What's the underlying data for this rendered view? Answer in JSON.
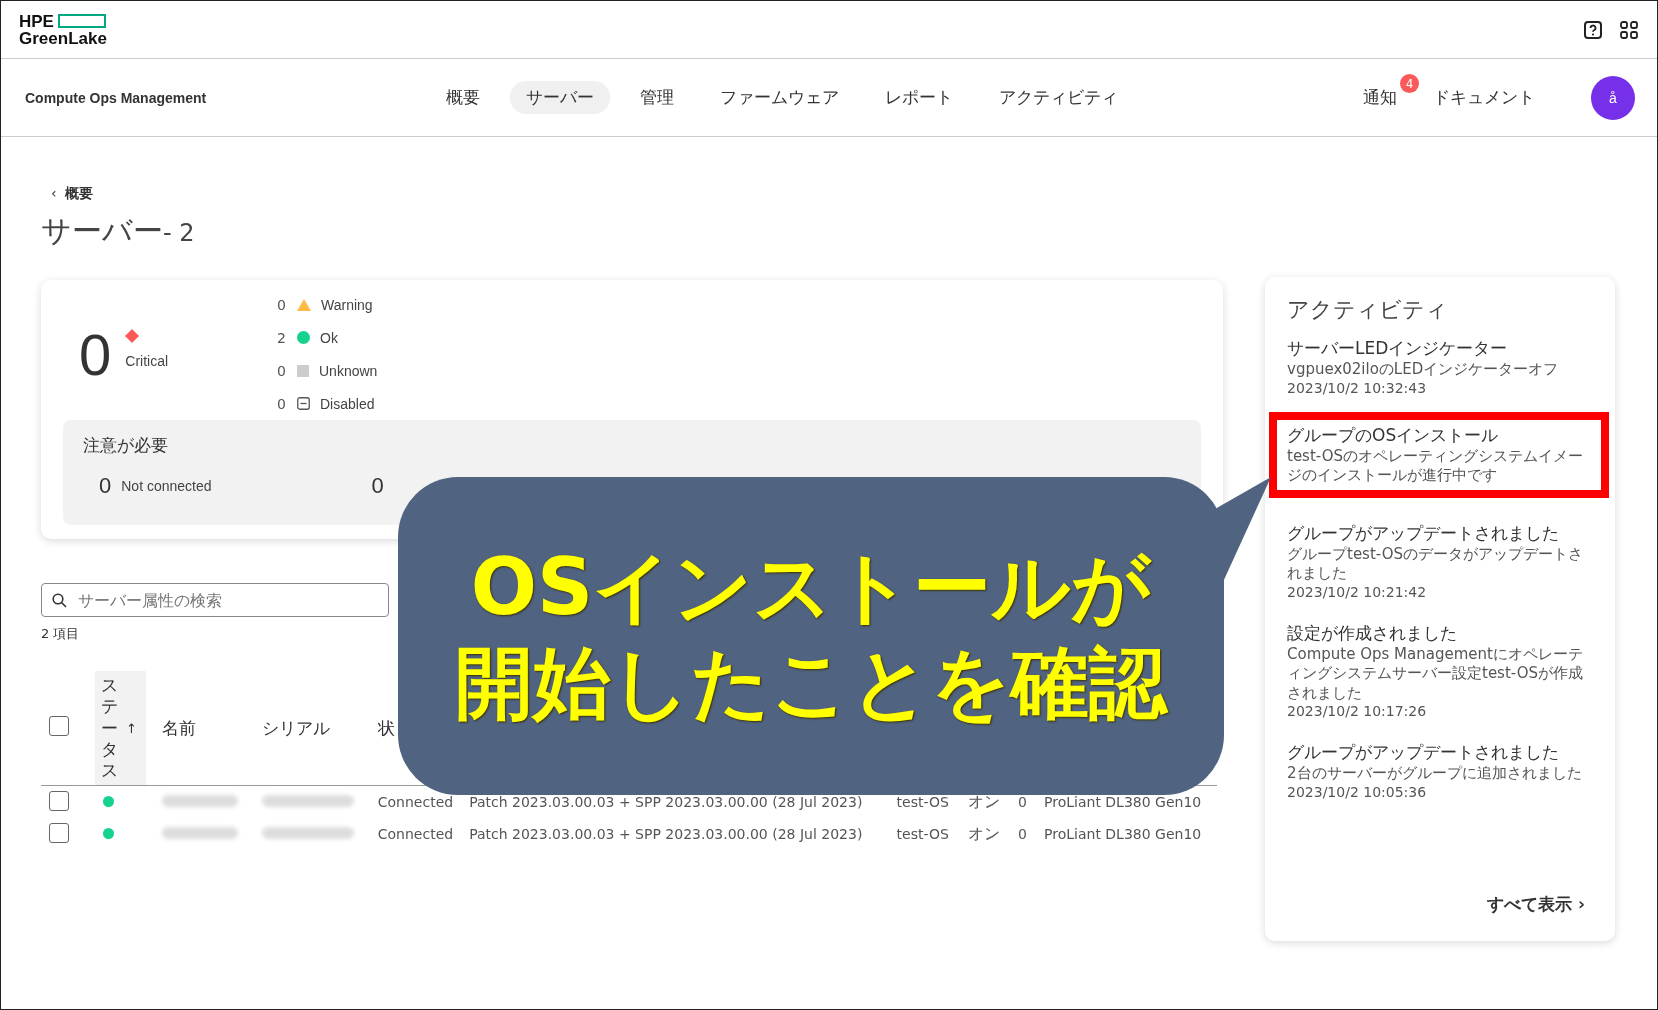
{
  "brand": {
    "line1": "HPE",
    "line2": "GreenLake"
  },
  "app_name": "Compute Ops Management",
  "nav": [
    {
      "label": "概要",
      "selected": false
    },
    {
      "label": "サーバー",
      "selected": true
    },
    {
      "label": "管理",
      "selected": false
    },
    {
      "label": "ファームウェア",
      "selected": false
    },
    {
      "label": "レポート",
      "selected": false
    },
    {
      "label": "アクティビティ",
      "selected": false
    }
  ],
  "notifications": {
    "label": "通知",
    "count": "4"
  },
  "docs_link": "ドキュメント",
  "avatar": "å",
  "breadcrumb": {
    "arrow": "‹",
    "label": "概要"
  },
  "page_title": {
    "text": "サーバー",
    "count": "- 2"
  },
  "summary": {
    "critical_count": "0",
    "critical_label": "Critical",
    "statuses": [
      {
        "count": "0",
        "kind": "warning",
        "label": "Warning"
      },
      {
        "count": "2",
        "kind": "ok",
        "label": "Ok"
      },
      {
        "count": "0",
        "kind": "unknown",
        "label": "Unknown"
      },
      {
        "count": "0",
        "kind": "disabled",
        "label": "Disabled"
      }
    ],
    "attention": {
      "title": "注意が必要",
      "items": [
        {
          "count": "0",
          "label": "Not connected"
        },
        {
          "count": "0"
        }
      ]
    }
  },
  "search": {
    "placeholder": "サーバー属性の検索"
  },
  "item_count": "2 項目",
  "table": {
    "select_all_checked": false,
    "columns": [
      {
        "label": "ステータス",
        "sort": "↑"
      },
      {
        "label": "名前"
      },
      {
        "label": "シリアル"
      },
      {
        "label": "状"
      }
    ],
    "rows": [
      {
        "checked": false,
        "color": "#17d18e",
        "state": "Connected",
        "firmware": "Patch 2023.03.00.03 + SPP 2023.03.00.00 (28 Jul 2023)",
        "group": "test-OS",
        "power": "オン",
        "column_7": "0",
        "model": "ProLiant DL380 Gen10"
      },
      {
        "checked": false,
        "color": "#17d18e",
        "state": "Connected",
        "firmware": "Patch 2023.03.00.03 + SPP 2023.03.00.00 (28 Jul 2023)",
        "group": "test-OS",
        "power": "オン",
        "column_7": "0",
        "model": "ProLiant DL380 Gen10"
      }
    ]
  },
  "activity": {
    "title": "アクティビティ",
    "items": [
      {
        "title": "サーバーLEDインジケーター",
        "text": "vgpuex02iloのLEDインジケーターオフ",
        "time": "2023/10/2 10:32:43",
        "highlighted": false
      },
      {
        "title": "グループのOSインストール",
        "text": "test-OSのオペレーティングシステムイメージのインストールが進行中です",
        "highlighted": true
      },
      {
        "title": "グループがアップデートされました",
        "text": "グループtest-OSのデータがアップデートされました",
        "time": "2023/10/2 10:21:42",
        "highlighted": false
      },
      {
        "title": "設定が作成されました",
        "text": "Compute Ops Managementにオペレーティングシステムサーバー設定test-OSが作成されました",
        "time": "2023/10/2 10:17:26",
        "highlighted": false
      },
      {
        "title": "グループがアップデートされました",
        "text": "2台のサーバーがグループに追加されました",
        "time": "2023/10/2 10:05:36",
        "highlighted": false
      }
    ],
    "view_all": "すべて表示",
    "view_all_arrow": "›"
  },
  "callout": {
    "lines": [
      "OSインストールが",
      "開始したことを確認"
    ]
  }
}
